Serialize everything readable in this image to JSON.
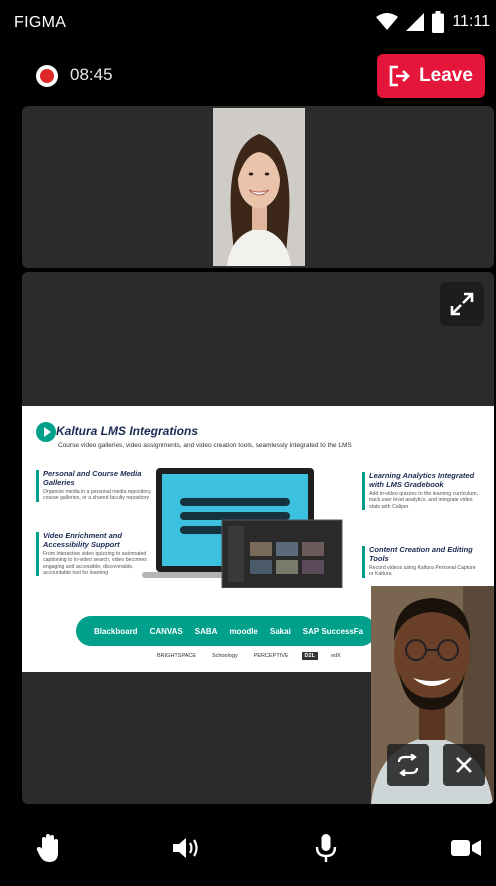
{
  "statusbar": {
    "carrier": "FIGMA",
    "time": "11:11",
    "icons": [
      "wifi-icon",
      "cellular-signal-icon",
      "battery-icon"
    ]
  },
  "call": {
    "recording_icon": "record-icon",
    "elapsed": "08:45",
    "leave_label": "Leave",
    "leave_icon": "exit-icon",
    "accent": "#e5163b"
  },
  "participants": [
    {
      "name": "woman-video-tile"
    },
    {
      "name": "man-video-pip"
    }
  ],
  "screen_share": {
    "expand_icon": "expand-icon",
    "slide": {
      "title": "Kaltura LMS Integrations",
      "subtitle": "Course video galleries, video assignments, and video creation tools, seamlessly integrated to the LMS",
      "blocks": [
        {
          "heading": "Personal and Course Media Galleries",
          "body": "Organize media in a personal media repository, course galleries, or a shared faculty repository"
        },
        {
          "heading": "Video Enrichment and Accessibility Support",
          "body": "From interactive video quizzing to automated captioning to in-video search, video becomes engaging and accessible, discoverable, accountable tool for learning"
        },
        {
          "heading": "Learning Analytics Integrated with LMS Gradebook",
          "body": "Add in-video quizzes to the learning curriculum, track user level analytics, and integrate video stats with Caliper"
        },
        {
          "heading": "Content Creation and Editing Tools",
          "body": "Record videos using Kaltura Personal Capture or Kaltura"
        }
      ],
      "lms_logos": [
        "Blackboard",
        "CANVAS",
        "SABA",
        "moodle",
        "Sakai",
        "SAP SuccessFa"
      ],
      "partner_logos": [
        "BRIGHTSPACE",
        "Schoology",
        "PERCEPTIVE",
        "D2L",
        "edX"
      ],
      "brand_color": "#00a08a"
    },
    "pip_controls": {
      "swap_icon": "switch-camera-icon",
      "close_icon": "close-icon"
    }
  },
  "controls": [
    {
      "name": "raise-hand",
      "icon": "hand-icon"
    },
    {
      "name": "speaker",
      "icon": "speaker-icon"
    },
    {
      "name": "microphone",
      "icon": "microphone-icon"
    },
    {
      "name": "camera",
      "icon": "video-camera-icon"
    }
  ]
}
